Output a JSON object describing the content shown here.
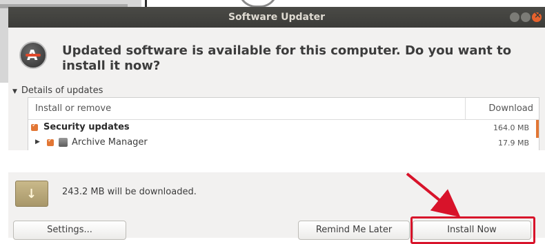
{
  "window": {
    "title": "Software Updater"
  },
  "header": {
    "headline": "Updated software is available for this computer. Do you want to install it now?"
  },
  "details": {
    "label": "Details of updates",
    "columns": [
      "Install or remove",
      "Download"
    ],
    "rows": [
      {
        "label": "Security updates",
        "size": "164.0 MB",
        "checked": true,
        "bold": true
      },
      {
        "label": "Archive Manager",
        "size": "17.9 MB",
        "checked": true,
        "bold": false,
        "expandable": true
      }
    ]
  },
  "summary": {
    "download_text": "243.2 MB will be downloaded."
  },
  "buttons": {
    "settings": "Settings...",
    "remind": "Remind Me Later",
    "install": "Install Now"
  },
  "colors": {
    "accent": "#e27634",
    "annotation": "#d8132a",
    "titlebar": "#3c3c39"
  }
}
